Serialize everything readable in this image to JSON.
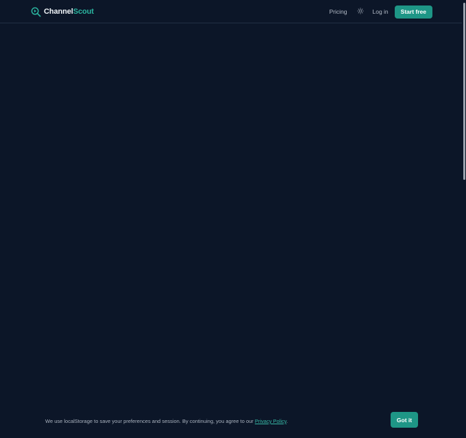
{
  "header": {
    "brand": {
      "name_part1": "Channel",
      "name_part2": "Scout",
      "icon": "magnifier-play-icon"
    },
    "nav": {
      "pricing_label": "Pricing",
      "theme_toggle_icon": "sun-icon",
      "login_label": "Log in",
      "cta_label": "Start free"
    }
  },
  "cookie_banner": {
    "text_before": "We use localStorage to save your preferences and session. By continuing, you agree to our ",
    "link_label": "Privacy Policy",
    "text_after": ".",
    "button_label": "Got it"
  },
  "colors": {
    "background": "#0c1628",
    "accent": "#1e9686",
    "accent_text": "#2bb5a0",
    "header_border": "#223044"
  }
}
